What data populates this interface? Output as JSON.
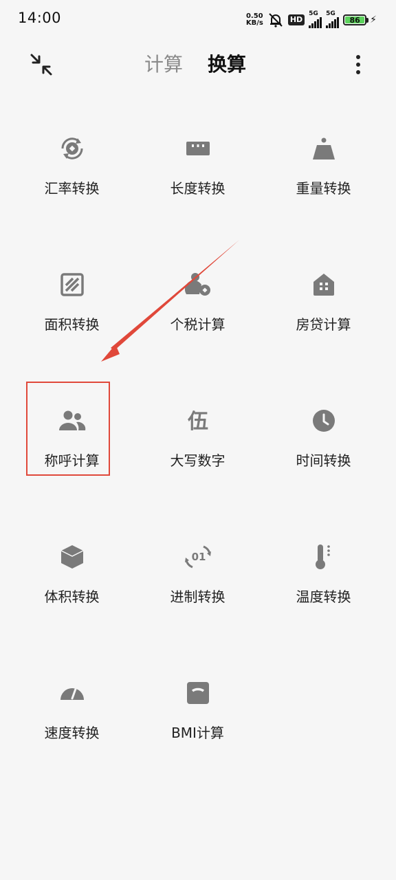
{
  "status_bar": {
    "time": "14:00",
    "net_speed_value": "0.50",
    "net_speed_unit": "KB/s",
    "hd_label": "HD",
    "sim1_label": "5G",
    "sim2_label": "5G",
    "battery_level": "86"
  },
  "header": {
    "tabs": [
      {
        "label": "计算",
        "active": false
      },
      {
        "label": "换算",
        "active": true
      }
    ]
  },
  "tools": [
    {
      "label": "汇率转换",
      "icon": "currency-exchange-icon"
    },
    {
      "label": "长度转换",
      "icon": "ruler-icon"
    },
    {
      "label": "重量转换",
      "icon": "weight-icon"
    },
    {
      "label": "面积转换",
      "icon": "area-icon"
    },
    {
      "label": "个税计算",
      "icon": "tax-person-icon"
    },
    {
      "label": "房贷计算",
      "icon": "house-icon"
    },
    {
      "label": "称呼计算",
      "icon": "people-icon"
    },
    {
      "label": "大写数字",
      "icon": "chinese-numeral-icon"
    },
    {
      "label": "时间转换",
      "icon": "clock-icon"
    },
    {
      "label": "体积转换",
      "icon": "cube-icon"
    },
    {
      "label": "进制转换",
      "icon": "binary-cycle-icon"
    },
    {
      "label": "温度转换",
      "icon": "thermometer-icon"
    },
    {
      "label": "速度转换",
      "icon": "speedometer-icon"
    },
    {
      "label": "BMI计算",
      "icon": "scale-icon"
    }
  ],
  "numeral_glyph": "伍",
  "binary_glyph": "01",
  "colors": {
    "background": "#f6f6f6",
    "icon": "#7a7a7a",
    "highlight": "#e0483a",
    "battery": "#5dd35d"
  }
}
